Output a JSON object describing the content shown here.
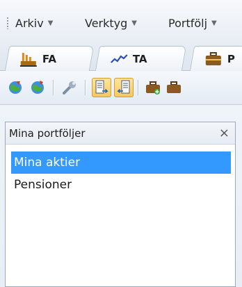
{
  "menubar": {
    "items": [
      {
        "label": "Arkiv",
        "caret": "▼"
      },
      {
        "label": "Verktyg",
        "caret": "▼"
      },
      {
        "label": "Portfölj",
        "caret": "▼"
      }
    ]
  },
  "tabs": [
    {
      "label": "FA",
      "icon": "factory-icon"
    },
    {
      "label": "TA",
      "icon": "trend-line-icon"
    },
    {
      "label": "P",
      "icon": "briefcase-icon"
    }
  ],
  "toolbar": {
    "buttons": [
      {
        "icon": "globe-down-icon"
      },
      {
        "icon": "globe-refresh-icon"
      },
      {
        "icon": "wrench-icon"
      },
      {
        "icon": "document-arrow-right-icon",
        "pressed": true
      },
      {
        "icon": "document-arrow-left-icon",
        "pressed": true
      },
      {
        "icon": "briefcase-add-icon"
      },
      {
        "icon": "briefcase-icon"
      }
    ]
  },
  "panel": {
    "title": "Mina portföljer",
    "close_label": "×",
    "items": [
      {
        "label": "Mina aktier",
        "selected": true
      },
      {
        "label": "Pensioner",
        "selected": false
      }
    ]
  },
  "colors": {
    "selection": "#3399ff",
    "pressed_button": "#f7c85c"
  }
}
